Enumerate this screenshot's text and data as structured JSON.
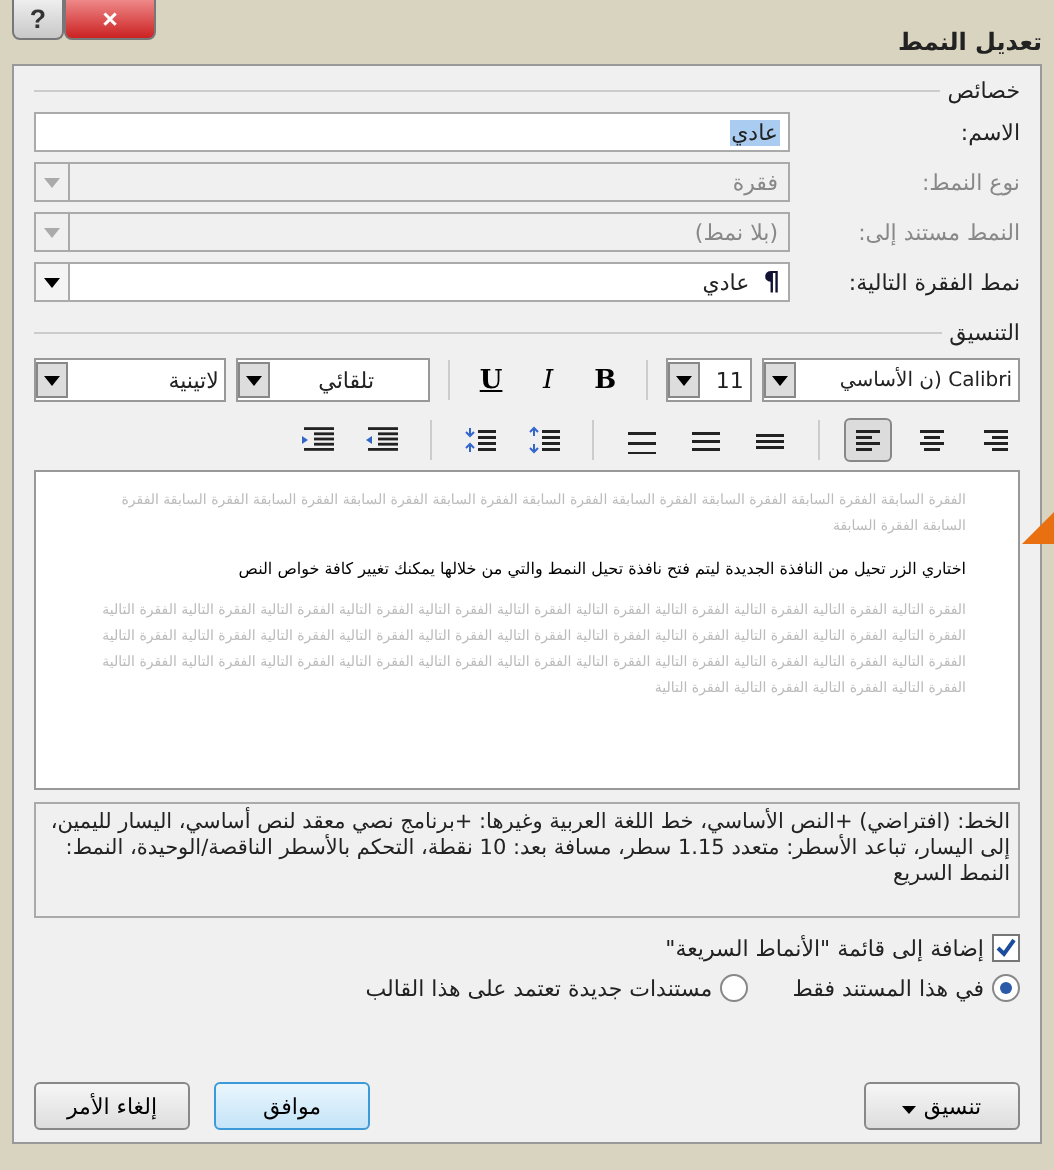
{
  "window": {
    "title": "تعديل النمط",
    "help": "?",
    "close": "×"
  },
  "properties": {
    "heading": "خصائص",
    "rows": [
      {
        "label": "الاسم:",
        "value": "عادي",
        "kind": "text",
        "disabled": false,
        "highlighted": true
      },
      {
        "label": "نوع النمط:",
        "value": "فقرة",
        "kind": "select",
        "disabled": true,
        "highlighted": false
      },
      {
        "label": "النمط مستند إلى:",
        "value": "(بلا نمط)",
        "kind": "select",
        "disabled": true,
        "highlighted": false
      },
      {
        "label": "نمط الفقرة التالية:",
        "value": "عادي",
        "kind": "select",
        "disabled": false,
        "highlighted": false,
        "mark": "¶"
      }
    ]
  },
  "formatting": {
    "heading": "التنسيق",
    "font": "Calibri (ن الأساسي",
    "size": "11",
    "styles": [
      {
        "label": "B",
        "kind": "bold"
      },
      {
        "label": "I",
        "kind": "italic"
      },
      {
        "label": "U",
        "kind": "underline"
      }
    ],
    "font_color": "تلقائي",
    "script": "لاتينية",
    "tools": [
      {
        "kind": "align-right",
        "selected": false
      },
      {
        "kind": "align-center",
        "selected": false
      },
      {
        "kind": "align-left",
        "selected": true
      },
      {
        "kind": "sep"
      },
      {
        "kind": "spacing-single",
        "selected": false
      },
      {
        "kind": "spacing-half",
        "selected": false
      },
      {
        "kind": "spacing-double",
        "selected": false
      },
      {
        "kind": "sep"
      },
      {
        "kind": "space-before",
        "selected": false
      },
      {
        "kind": "space-after",
        "selected": false
      },
      {
        "kind": "sep"
      },
      {
        "kind": "indent-less",
        "selected": false
      },
      {
        "kind": "indent-more",
        "selected": false
      }
    ]
  },
  "preview": {
    "previous": "الفقرة السابقة الفقرة السابقة الفقرة السابقة الفقرة السابقة الفقرة السابقة الفقرة السابقة الفقرة السابقة الفقرة السابقة الفقرة السابقة الفقرة السابقة الفقرة السابقة",
    "sample": "اختاري الزر تحيل من النافذة الجديدة ليتم فتح نافذة تحيل النمط والتي من خلالها يمكنك تغيير كافة خواص النص",
    "next": "الفقرة التالية الفقرة التالية الفقرة التالية الفقرة التالية الفقرة التالية الفقرة التالية الفقرة التالية الفقرة التالية الفقرة التالية الفقرة التالية الفقرة التالية الفقرة التالية الفقرة التالية الفقرة التالية الفقرة التالية الفقرة التالية الفقرة التالية الفقرة التالية الفقرة التالية الفقرة التالية الفقرة التالية الفقرة التالية الفقرة التالية الفقرة التالية الفقرة التالية الفقرة التالية الفقرة التالية الفقرة التالية الفقرة التالية الفقرة التالية الفقرة التالية الفقرة التالية الفقرة التالية الفقرة التالية الفقرة التالية الفقرة التالية الفقرة التالية"
  },
  "description": "الخط: (افتراضي) +النص الأساسي، خط اللغة العربية وغيرها: +برنامج نصي معقد لنص أساسي، اليسار لليمين، إلى اليسار، تباعد الأسطر: متعدد 1.15 سطر، مسافة بعد: 10 نقطة، التحكم بالأسطر الناقصة/الوحيدة، النمط: النمط السريع",
  "add_to_quick": {
    "label": "إضافة إلى قائمة \"الأنماط السريعة\"",
    "checked": true
  },
  "scope": [
    {
      "label": "في هذا المستند فقط",
      "selected": true
    },
    {
      "label": "مستندات جديدة تعتمد على هذا القالب",
      "selected": false
    }
  ],
  "buttons": [
    {
      "label": "تنسيق",
      "kind": "menu",
      "default": false
    },
    {
      "label": "موافق",
      "kind": "ok",
      "default": true
    },
    {
      "label": "إلغاء الأمر",
      "kind": "cancel",
      "default": false
    }
  ]
}
